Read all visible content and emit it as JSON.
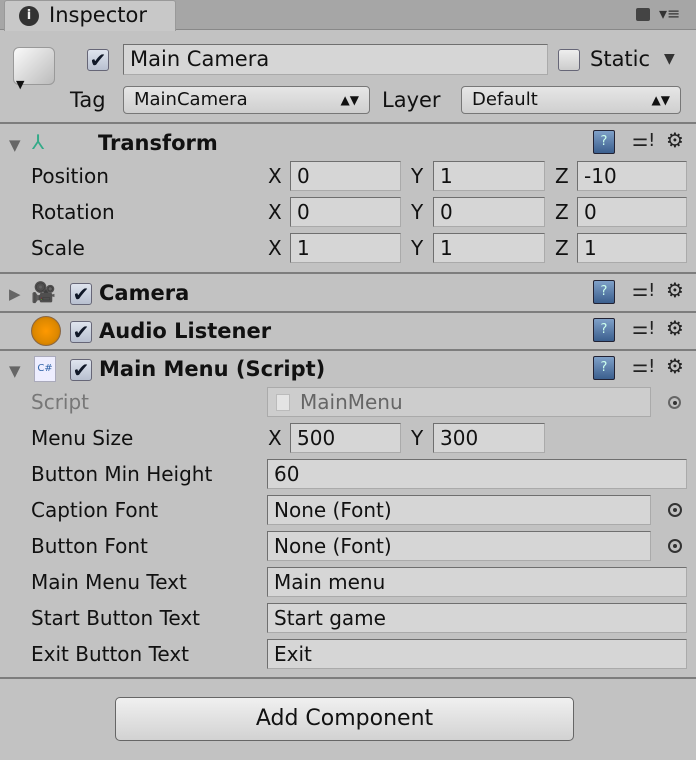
{
  "tab": {
    "title": "Inspector",
    "icon": "info-icon"
  },
  "object": {
    "active": true,
    "name": "Main Camera",
    "static_label": "Static",
    "static": false,
    "tag_label": "Tag",
    "tag": "MainCamera",
    "layer_label": "Layer",
    "layer": "Default"
  },
  "transform": {
    "title": "Transform",
    "rows": [
      {
        "label": "Position",
        "x": "0",
        "y": "1",
        "z": "-10"
      },
      {
        "label": "Rotation",
        "x": "0",
        "y": "0",
        "z": "0"
      },
      {
        "label": "Scale",
        "x": "1",
        "y": "1",
        "z": "1"
      }
    ],
    "axis": {
      "x": "X",
      "y": "Y",
      "z": "Z"
    }
  },
  "camera": {
    "title": "Camera",
    "enabled": true
  },
  "audio": {
    "title": "Audio Listener",
    "enabled": true
  },
  "script": {
    "title": "Main Menu (Script)",
    "enabled": true,
    "script_label": "Script",
    "script_value": "MainMenu",
    "menu_size_label": "Menu Size",
    "menu_size_x": "500",
    "menu_size_y": "300",
    "fields": [
      {
        "label": "Button Min Height",
        "value": "60"
      },
      {
        "label": "Caption Font",
        "value": "None (Font)"
      },
      {
        "label": "Button Font",
        "value": "None (Font)"
      },
      {
        "label": "Main Menu Text",
        "value": "Main menu"
      },
      {
        "label": "Start Button Text",
        "value": "Start game"
      },
      {
        "label": "Exit Button Text",
        "value": "Exit"
      }
    ]
  },
  "add_component": "Add Component"
}
